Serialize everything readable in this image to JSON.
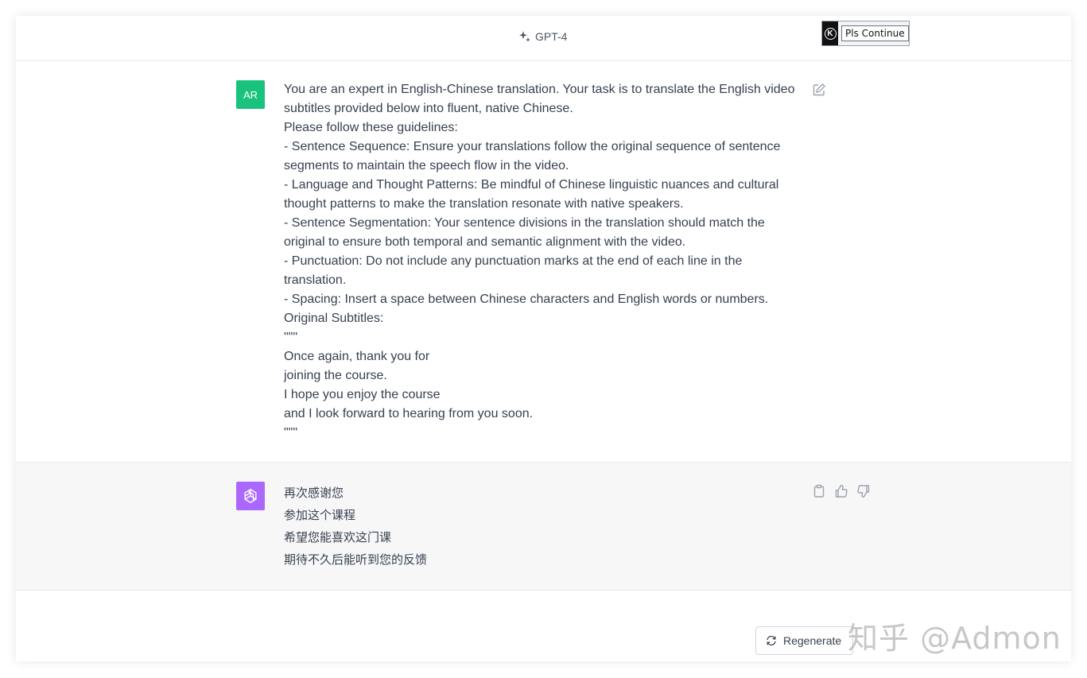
{
  "header": {
    "model_name": "GPT-4",
    "extension_button_label": "Pls Continue",
    "extension_logo_letter": "K"
  },
  "user_message": {
    "avatar_initials": "AR",
    "avatar_color": "#19c37d",
    "text": "You are an expert in English-Chinese translation. Your task is to translate the English video subtitles provided below into fluent, native Chinese.\nPlease follow these guidelines:\n- Sentence Sequence: Ensure your translations follow the original sequence of sentence segments to maintain the speech flow in the video.\n- Language and Thought Patterns: Be mindful of Chinese linguistic nuances and cultural thought patterns to make the translation resonate with native speakers.\n- Sentence Segmentation: Your sentence divisions in the translation should match the original to ensure both temporal and semantic alignment with the video.\n- Punctuation: Do not include any punctuation marks at the end of each line in the translation.\n- Spacing: Insert a space between Chinese characters and English words or numbers.\nOriginal Subtitles:\n\"\"\"\nOnce again, thank you for\njoining the course.\nI hope you enjoy the course\nand I look forward to hearing from you soon.\n\"\"\""
  },
  "assistant_message": {
    "avatar_color": "#ab68ff",
    "lines": [
      "再次感谢您",
      "参加这个课程",
      "希望您能喜欢这门课",
      "期待不久后能听到您的反馈"
    ]
  },
  "footer": {
    "regenerate_label": "Regenerate"
  },
  "watermark": {
    "text": "知乎 @Admon"
  },
  "icons": {
    "model": "sparkle-icon",
    "edit": "edit-icon",
    "copy": "clipboard-icon",
    "like": "thumbs-up-icon",
    "dislike": "thumbs-down-icon",
    "regenerate": "refresh-icon",
    "assistant_avatar": "openai-logo-icon"
  }
}
